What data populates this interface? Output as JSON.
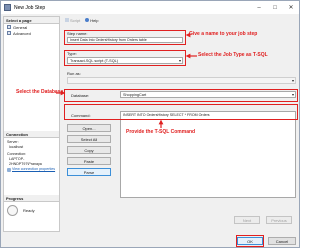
{
  "window": {
    "title": "New Job Step"
  },
  "left": {
    "select_page_header": "Select a page",
    "pages": [
      "General",
      "Advanced"
    ],
    "connection_header": "Connection",
    "server_label": "Server:",
    "server_value": "localhost",
    "connection_label": "Connection:",
    "connection_value": "LAPTOP-2HNDPT97\\Pranaya",
    "view_connection_link": "View connection properties",
    "progress_header": "Progress",
    "ready_text": "Ready"
  },
  "toolbar": {
    "script_label": "Script",
    "help_label": "Help"
  },
  "form": {
    "step_name_label": "Step name:",
    "step_name_value": "Insert Data Into OrdersHistory from Orders table",
    "type_label": "Type:",
    "type_value": "Transact-SQL script (T-SQL)",
    "run_as_label": "Run as:",
    "database_label": "Database:",
    "database_value": "ShoppingCart",
    "command_label": "Command:",
    "command_value": "INSERT INTO OrdersHistory SELECT * FROM Orders"
  },
  "buttons": {
    "open": "Open...",
    "select_all": "Select All",
    "copy": "Copy",
    "paste": "Paste",
    "parse": "Parse",
    "next": "Next",
    "previous": "Previous",
    "ok": "OK",
    "cancel": "Cancel"
  },
  "annotations": {
    "step_name": "Give a name to your job step",
    "job_type": "Select the Job Type as T-SQL",
    "database": "Select the Database",
    "command": "Provide the T-SQL Command"
  },
  "colors": {
    "annotation_red": "#e02020",
    "link_blue": "#1a5fb4"
  }
}
